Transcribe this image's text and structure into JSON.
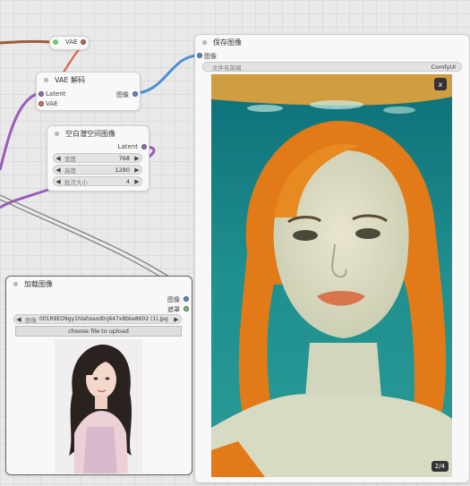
{
  "colors": {
    "vae_wire": "#d94d3a",
    "image_wire": "#4a8fd6",
    "latent_wire": "#a060c8",
    "mask_wire": "#66cc66"
  },
  "vae_node": {
    "label": "VAE"
  },
  "vae_decode": {
    "title": "VAE 解码",
    "inputs": [
      "Latent",
      "VAE"
    ],
    "output": "图像"
  },
  "empty_latent": {
    "title": "空白潜空间图像",
    "output": "Latent",
    "widgets": [
      {
        "name": "宽度",
        "value": "768"
      },
      {
        "name": "高度",
        "value": "1280"
      },
      {
        "name": "批次大小",
        "value": "4"
      }
    ]
  },
  "save_image": {
    "title": "保存图像",
    "input": "图像",
    "prefix_name": "文件名前缀",
    "prefix_value": "ComfyUI",
    "close": "x",
    "counter": "2/4"
  },
  "load_image": {
    "title": "加载图像",
    "outputs": [
      "图像",
      "遮罩"
    ],
    "image_label": "图像",
    "image_value": "001R9EO9gy1hlahsaodlnj647x8bke8602 (1).jpg",
    "upload_label": "choose file to upload"
  }
}
